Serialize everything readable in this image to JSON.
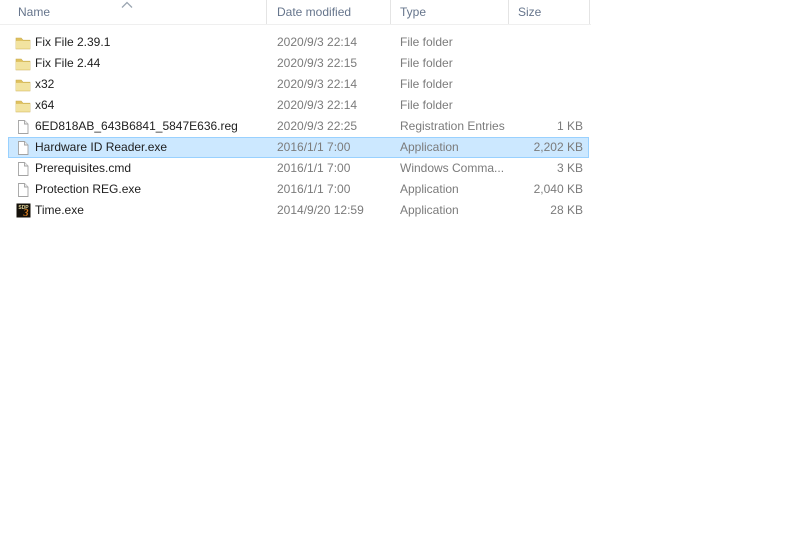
{
  "window": {
    "background": "#ffffff"
  },
  "file_list": {
    "sort": {
      "column": "Name",
      "direction": "ascending",
      "glyph": "chevron-up-icon"
    },
    "columns": [
      {
        "id": "name",
        "label": "Name"
      },
      {
        "id": "date_modified",
        "label": "Date modified"
      },
      {
        "id": "type",
        "label": "Type"
      },
      {
        "id": "size",
        "label": "Size"
      }
    ],
    "files": [
      {
        "name": "Fix File 2.39.1",
        "date_modified": "2020/9/3 22:14",
        "type": "File folder",
        "size": "",
        "icon": "folder-icon",
        "selected": false
      },
      {
        "name": "Fix File 2.44",
        "date_modified": "2020/9/3 22:15",
        "type": "File folder",
        "size": "",
        "icon": "folder-icon",
        "selected": false
      },
      {
        "name": "x32",
        "date_modified": "2020/9/3 22:14",
        "type": "File folder",
        "size": "",
        "icon": "folder-icon",
        "selected": false
      },
      {
        "name": "x64",
        "date_modified": "2020/9/3 22:14",
        "type": "File folder",
        "size": "",
        "icon": "folder-icon",
        "selected": false
      },
      {
        "name": "6ED818AB_643B6841_5847E636.reg",
        "date_modified": "2020/9/3 22:25",
        "type": "Registration Entries",
        "size": "1 KB",
        "icon": "blank-file-icon",
        "selected": false
      },
      {
        "name": "Hardware ID Reader.exe",
        "date_modified": "2016/1/1 7:00",
        "type": "Application",
        "size": "2,202 KB",
        "icon": "blank-file-icon",
        "selected": true
      },
      {
        "name": "Prerequisites.cmd",
        "date_modified": "2016/1/1 7:00",
        "type": "Windows Comma...",
        "size": "3 KB",
        "icon": "blank-file-icon",
        "selected": false
      },
      {
        "name": "Protection REG.exe",
        "date_modified": "2016/1/1 7:00",
        "type": "Application",
        "size": "2,040 KB",
        "icon": "blank-file-icon",
        "selected": false
      },
      {
        "name": "Time.exe",
        "date_modified": "2014/9/20 12:59",
        "type": "Application",
        "size": "28 KB",
        "icon": "sdp3-app-icon",
        "selected": false
      }
    ],
    "sdp3_icon_text": {
      "top": "SDP",
      "number": "3"
    }
  },
  "colors": {
    "selection_background": "#cce8ff",
    "selection_border": "#99d1ff",
    "header_text": "#66758c",
    "primary_text": "#1e1e1e",
    "secondary_text": "#7b7b7b",
    "column_separator": "#e4e4e4",
    "folder_face": "#f2e3a0",
    "folder_back": "#dfc15f",
    "sdp3_background": "#14100a",
    "sdp3_number": "#e0801f"
  }
}
